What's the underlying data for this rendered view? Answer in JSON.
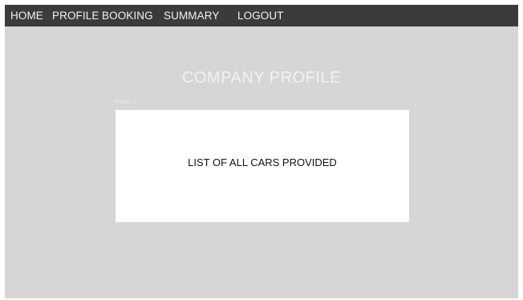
{
  "nav": {
    "home": "HOME",
    "profile": "PROFILE",
    "booking": "BOOKING",
    "summary": "SUMMARY",
    "logout": "LOGOUT"
  },
  "main": {
    "title": "COMPANY PROFILE",
    "frame_label": "Frame 1",
    "card_text": "LIST OF ALL CARS PROVIDED"
  },
  "colors": {
    "navbar_bg": "#3b3b3b",
    "page_bg": "#d6d6d6",
    "card_bg": "#ffffff"
  }
}
